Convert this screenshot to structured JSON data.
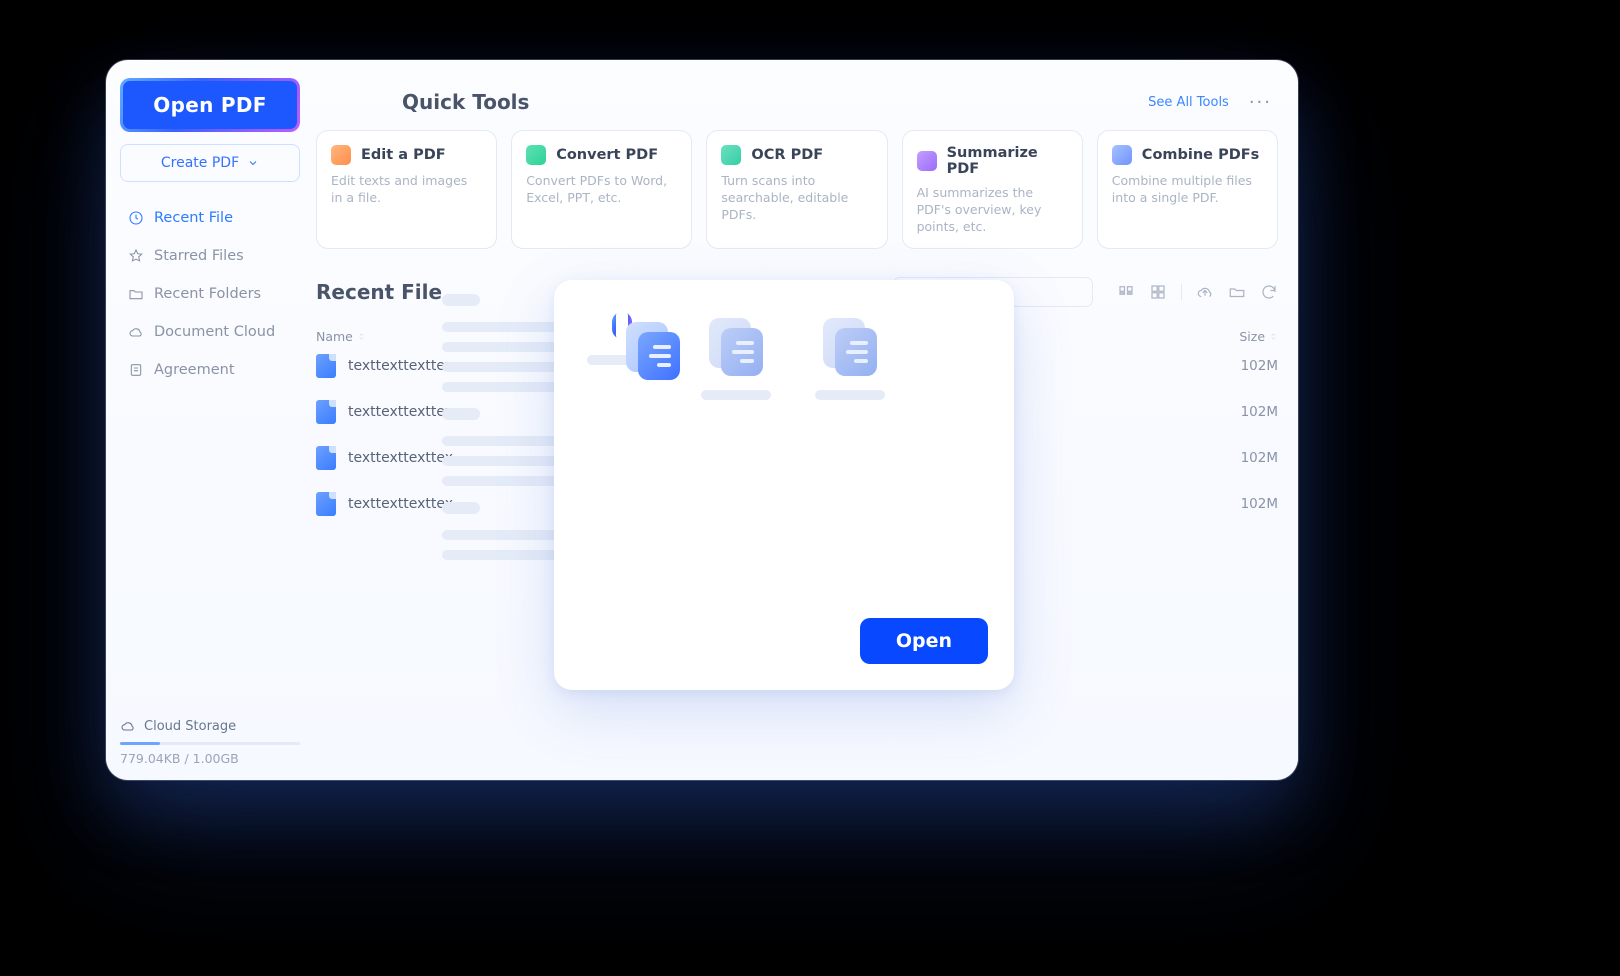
{
  "sidebar": {
    "open_pdf_label": "Open PDF",
    "create_pdf_label": "Create PDF",
    "nav": [
      {
        "label": "Recent File",
        "icon": "clock-icon",
        "active": true
      },
      {
        "label": "Starred Files",
        "icon": "star-icon",
        "active": false
      },
      {
        "label": "Recent Folders",
        "icon": "folder-icon",
        "active": false
      },
      {
        "label": "Document Cloud",
        "icon": "cloud-icon",
        "active": false
      },
      {
        "label": "Agreement",
        "icon": "agreement-icon",
        "active": false
      }
    ],
    "storage": {
      "title": "Cloud Storage",
      "caption": "779.04KB / 1.00GB",
      "used_ratio": 0.22
    }
  },
  "quick_tools": {
    "heading": "Quick Tools",
    "see_all_label": "See All Tools",
    "items": [
      {
        "title": "Edit a PDF",
        "desc": "Edit texts and images in a file.",
        "icon_class": "ti-edit"
      },
      {
        "title": "Convert PDF",
        "desc": "Convert PDFs to Word, Excel, PPT, etc.",
        "icon_class": "ti-convert"
      },
      {
        "title": "OCR PDF",
        "desc": "Turn scans into searchable, editable PDFs.",
        "icon_class": "ti-ocr"
      },
      {
        "title": "Summarize PDF",
        "desc": "AI summarizes the PDF's overview, key points, etc.",
        "icon_class": "ti-sum"
      },
      {
        "title": "Combine PDFs",
        "desc": "Combine multiple files into a single PDF.",
        "icon_class": "ti-comb"
      }
    ]
  },
  "recent": {
    "heading": "Recent File",
    "columns": {
      "name": "Name",
      "size": "Size"
    },
    "rows": [
      {
        "name": "texttexttexttex",
        "size": "102M"
      },
      {
        "name": "texttexttexttex",
        "size": "102M"
      },
      {
        "name": "texttexttexttex",
        "size": "102M"
      },
      {
        "name": "texttexttexttex",
        "size": "102M"
      }
    ]
  },
  "modal": {
    "open_label": "Open"
  },
  "colors": {
    "accent": "#1d58ff",
    "highlight_gradient_start": "#5facff",
    "highlight_gradient_mid": "#3a62ff",
    "highlight_gradient_end": "#c25bff"
  }
}
